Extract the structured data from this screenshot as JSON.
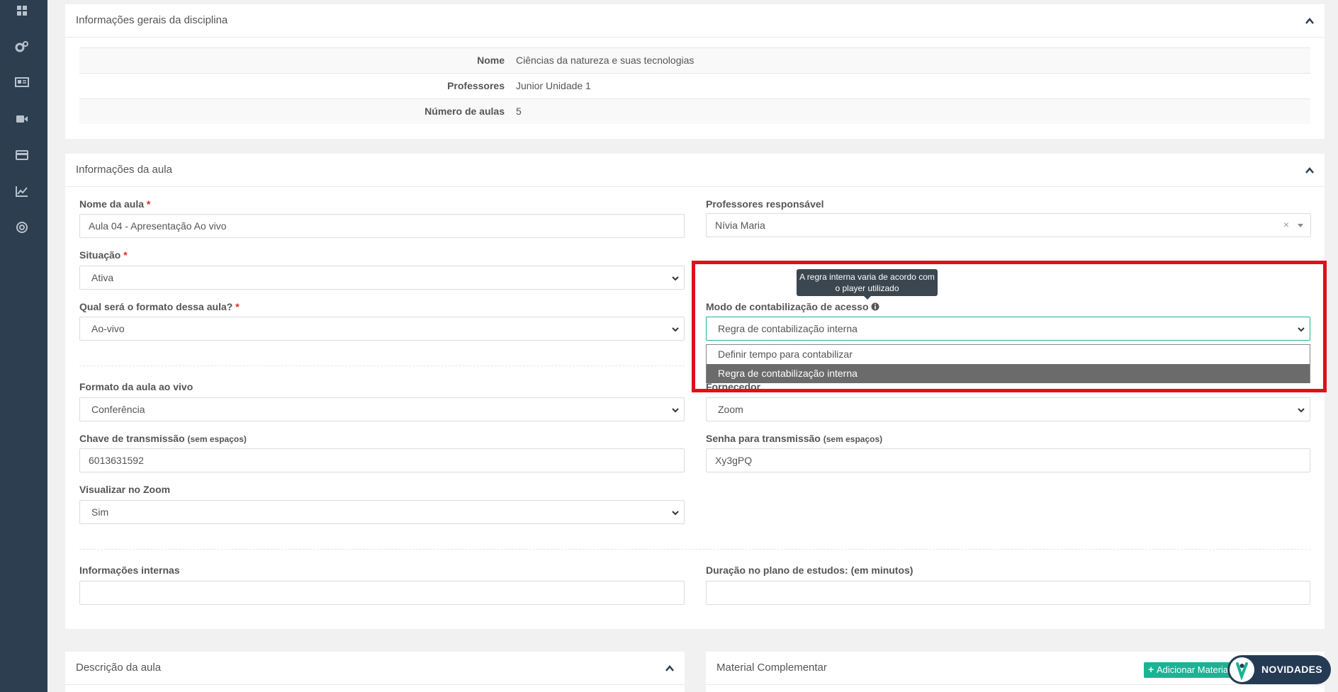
{
  "sidebar": {
    "icons": [
      "dashboard-icon",
      "cogs-icon",
      "newspaper-icon",
      "video-camera-icon",
      "credit-card-icon",
      "line-chart-icon",
      "support-icon"
    ]
  },
  "discipline_panel": {
    "title": "Informações gerais da disciplina",
    "rows": [
      {
        "label": "Nome",
        "value": "Ciências da natureza e suas tecnologias"
      },
      {
        "label": "Professores",
        "value": "Junior Unidade 1"
      },
      {
        "label": "Número de aulas",
        "value": "5"
      }
    ]
  },
  "lesson_panel": {
    "title": "Informações da aula",
    "nome_aula": {
      "label": "Nome da aula",
      "required": "*",
      "value": "Aula 04 - Apresentação Ao vivo"
    },
    "professores": {
      "label": "Professores responsável",
      "value": "Nívia Maria",
      "clear": "×"
    },
    "situacao": {
      "label": "Situação",
      "required": "*",
      "value": "Ativa"
    },
    "formato": {
      "label": "Qual será o formato dessa aula?",
      "required": "*",
      "value": "Ao-vivo"
    },
    "modo": {
      "label": "Modo de contabilização de acesso",
      "value": "Regra de contabilização interna",
      "tooltip": "A regra interna varia de acordo com o player utilizado",
      "options": [
        {
          "label": "Definir tempo para contabilizar",
          "selected": false
        },
        {
          "label": "Regra de contabilização interna",
          "selected": true
        }
      ]
    },
    "formato_ao_vivo": {
      "label": "Formato da aula ao vivo",
      "value": "Conferência"
    },
    "fornecedor": {
      "label": "Fornecedor",
      "value": "Zoom"
    },
    "chave": {
      "label": "Chave de transmissão",
      "hint": "(sem espaços)",
      "value": "6013631592"
    },
    "senha": {
      "label": "Senha para transmissão",
      "hint": "(sem espaços)",
      "value": "Xy3gPQ"
    },
    "visualizar": {
      "label": "Visualizar no Zoom",
      "value": "Sim"
    },
    "info_internas": {
      "label": "Informações internas",
      "value": ""
    },
    "duracao": {
      "label": "Duração no plano de estudos: (em minutos)",
      "value": ""
    }
  },
  "descricao_panel": {
    "title": "Descrição da aula"
  },
  "material_panel": {
    "title": "Material Complementar",
    "add_button": "Adicionar Material",
    "add_icon": "+"
  },
  "novidades": {
    "label": "NOVIDADES"
  },
  "colors": {
    "sidebar": "#2c3e50",
    "accent_green": "#1ab394",
    "highlight_red": "#e0101a",
    "novidades_bg": "#243b53"
  }
}
